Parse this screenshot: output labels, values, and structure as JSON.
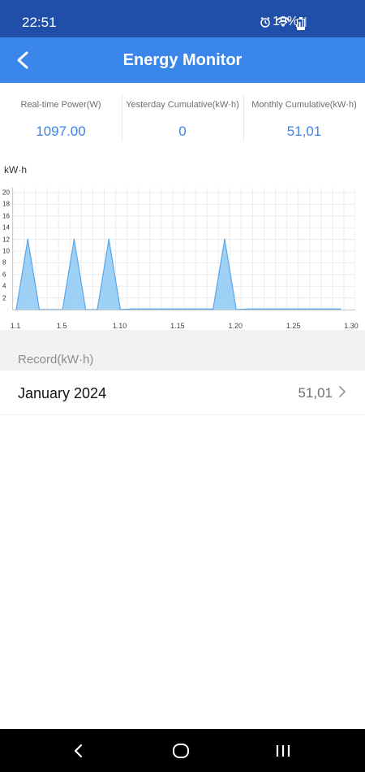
{
  "status_bar": {
    "time": "22:51",
    "battery": "19%",
    "icons": [
      "alarm-icon",
      "wifi-icon",
      "signal-icon",
      "battery-icon"
    ]
  },
  "header": {
    "title": "Energy Monitor",
    "back_icon": "back-arrow-icon"
  },
  "summary": [
    {
      "label": "Real-time Power(W)",
      "value": "1097.00"
    },
    {
      "label": "Yesterday Cumulative(kW·h)",
      "value": "0"
    },
    {
      "label": "Monthly Cumulative(kW·h)",
      "value": "51,01"
    }
  ],
  "chart_data": {
    "type": "area",
    "ylabel": "kW·h",
    "ylim": [
      0,
      20
    ],
    "y_ticks": [
      "20",
      "18",
      "16",
      "14",
      "12",
      "10",
      "8",
      "6",
      "4",
      "2"
    ],
    "x_ticks": [
      "1.1",
      "1.5",
      "1.10",
      "1.15",
      "1.20",
      "1.25",
      "1.30"
    ],
    "x": [
      1,
      2,
      3,
      4,
      5,
      6,
      7,
      8,
      9,
      10,
      11,
      12,
      13,
      14,
      15,
      16,
      17,
      18,
      19,
      20,
      21,
      22,
      23,
      24,
      25,
      26,
      27,
      28,
      29
    ],
    "values": [
      0,
      12,
      0,
      0,
      0,
      12,
      0,
      0,
      12,
      0,
      0.1,
      0.1,
      0.1,
      0.1,
      0.1,
      0.1,
      0.1,
      0.1,
      12,
      0,
      0.1,
      0.1,
      0.1,
      0.1,
      0.1,
      0.1,
      0.1,
      0.1,
      0.1
    ],
    "grid": true,
    "color": "#8ec8f5",
    "line_color": "#5aa7e8"
  },
  "records": {
    "section_label": "Record(kW·h)",
    "items": [
      {
        "month": "January 2024",
        "value": "51,01"
      }
    ]
  },
  "nav": {
    "icons": [
      "nav-back-icon",
      "nav-home-icon",
      "nav-recents-icon"
    ]
  },
  "colors": {
    "status_bar": "#1f4fa8",
    "header": "#3a86ea",
    "accent": "#3a86ea"
  }
}
